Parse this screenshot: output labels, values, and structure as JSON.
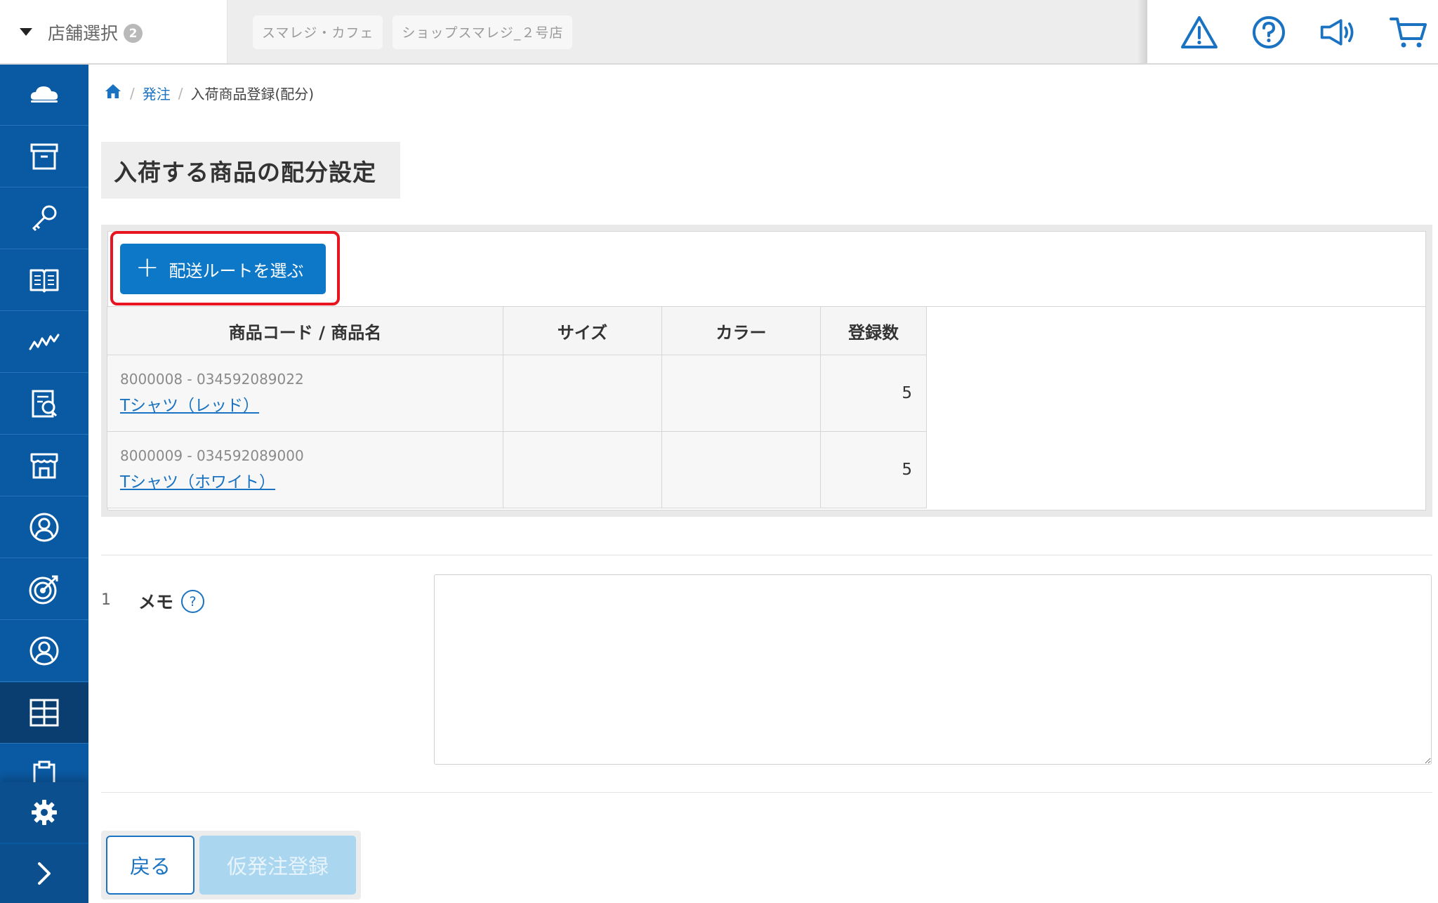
{
  "header": {
    "store_select_label": "店舗選択",
    "store_count": "2",
    "stores": [
      "スマレジ・カフェ",
      "ショップスマレジ_２号店"
    ],
    "icons": [
      "warning-icon",
      "help-icon",
      "megaphone-icon",
      "cart-icon"
    ]
  },
  "sidebar": {
    "items": [
      "cloud-icon",
      "archive-icon",
      "key-icon",
      "book-icon",
      "chart-icon",
      "report-icon",
      "store-icon",
      "customer-icon",
      "target-icon",
      "staff-icon",
      "order-grid-icon",
      "clipboard-icon"
    ],
    "active_item": "order-grid-icon",
    "bottom": [
      "settings-icon",
      "expand-icon"
    ]
  },
  "breadcrumb": {
    "home": "home-icon",
    "items": [
      "発注",
      "入荷商品登録(配分)"
    ]
  },
  "page_title": "入荷する商品の配分設定",
  "route_button": {
    "label": "配送ルートを選ぶ"
  },
  "table": {
    "headers": [
      "商品コード / 商品名",
      "サイズ",
      "カラー",
      "登録数"
    ],
    "rows": [
      {
        "code": "8000008 - 034592089022",
        "name": "Tシャツ（レッド）",
        "size": "",
        "color": "",
        "qty": "5"
      },
      {
        "code": "8000009 - 034592089000",
        "name": "Tシャツ（ホワイト）",
        "size": "",
        "color": "",
        "qty": "5"
      }
    ]
  },
  "memo": {
    "number": "1",
    "label": "メモ",
    "help": "?",
    "value": ""
  },
  "actions": {
    "back": "戻る",
    "submit": "仮発注登録"
  },
  "colors": {
    "sidebar": "#0a5aa3",
    "accent": "#0e78c8",
    "highlight": "#e8141f"
  }
}
